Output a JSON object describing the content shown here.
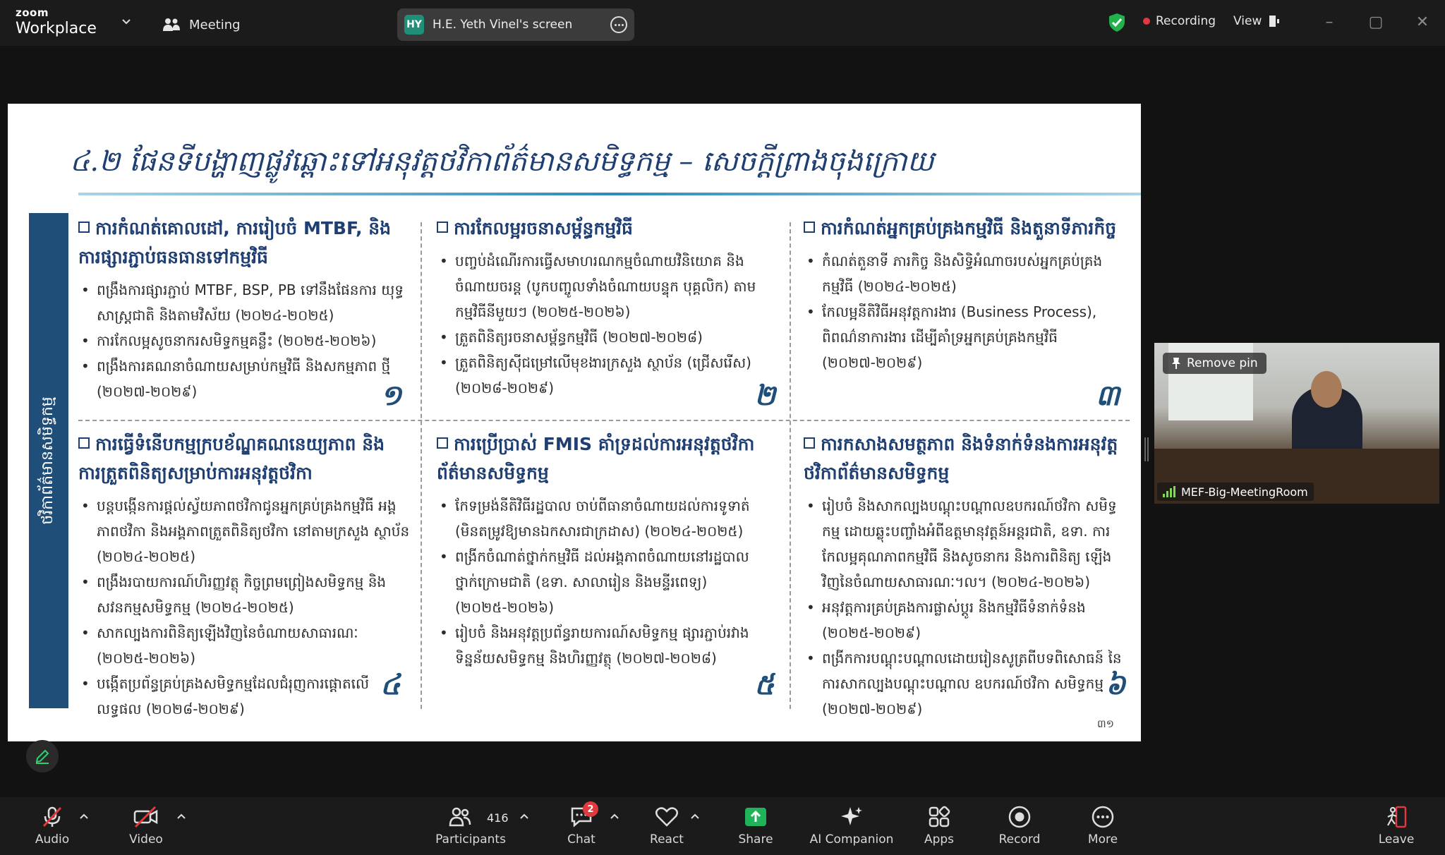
{
  "app": {
    "brand_small": "zoom",
    "brand_big": "Workplace"
  },
  "topbar": {
    "meeting_label": "Meeting",
    "screen_initials": "HY",
    "screen_label": "H.E. Yeth Vinel's screen",
    "recording_label": "Recording",
    "view_label": "View"
  },
  "slide": {
    "title": "៤.២ ផែនទីបង្ហាញផ្លូវឆ្ពោះទៅអនុវត្តថវិកាព័ត៌មានសមិទ្ធកម្ម – សេចក្តីព្រាងចុងក្រោយ",
    "side_label": "ថវិកាព័ត៌មានសមិទ្ធកម្ម",
    "page_number": "៣១",
    "cells": [
      {
        "heading": "ការកំណត់គោលដៅ, ការរៀបចំ MTBF, និង ការផ្សារភ្ជាប់ធនធានទៅកម្មវិធី",
        "bullets": [
          "ពង្រឹងការផ្សារភ្ជាប់ MTBF, BSP, PB ទៅនឹងផែនការ យុទ្ធសាស្ត្រជាតិ និងតាមវិស័យ (២០២៤-២០២៥)",
          "ការកែលម្អសូចនាករសមិទ្ធកម្មគន្លឹះ (២០២៥-២០២៦)",
          "ពង្រឹងការគណនាចំណាយសម្រាប់កម្មវិធី និងសកម្មភាព ថ្មី (២០២៧-២០២៩)"
        ],
        "number": "១"
      },
      {
        "heading": "ការកែលម្អរចនាសម្ព័ន្ធកម្មវិធី",
        "bullets": [
          "បញ្ចប់ដំណើរការធ្វើសមាហរណកម្មចំណាយវិនិយោគ និងចំណាយចរន្ត (បូកបញ្ចូលទាំងចំណាយបន្ទុក បុគ្គលិក) តាមកម្មវិធីនីមួយៗ (២០២៥-២០២៦)",
          "ត្រួតពិនិត្យរចនាសម្ព័ន្ធកម្មវិធី (២០២៧-២០២៨)",
          "ត្រួតពិនិត្យស៊ីជម្រៅលើមុខងារក្រសួង ស្ថាប័ន (ជ្រើសរើស) (២០២៨-២០២៩)"
        ],
        "number": "២"
      },
      {
        "heading": "ការកំណត់អ្នកគ្រប់គ្រងកម្មវិធី និងតួនាទីភារកិច្ច",
        "bullets": [
          "កំណត់តួនាទី ភារកិច្ច និងសិទ្ធិអំណាចរបស់អ្នកគ្រប់គ្រង កម្មវិធី (២០២៤-២០២៥)",
          "កែលម្អនីតិវិធីអនុវត្តការងារ (Business Process), ពិពណ៌នាការងារ ដើម្បីគាំទ្រអ្នកគ្រប់គ្រងកម្មវិធី (២០២៧-២០២៩)"
        ],
        "number": "៣"
      },
      {
        "heading": "ការធ្វើទំនើបកម្មក្របខ័ណ្ឌគណនេយ្យភាព និង ការត្រួតពិនិត្យសម្រាប់ការអនុវត្តថវិកា",
        "bullets": [
          "បន្តបង្កើនការផ្តល់ស្វ័យភាពថវិកាជូនអ្នកគ្រប់គ្រងកម្មវិធី អង្គភាពថវិកា និងអង្គភាពត្រួតពិនិត្យថវិកា នៅតាមក្រសួង ស្ថាប័ន (២០២៤-២០២៥)",
          "ពង្រឹងរបាយការណ៍ហិរញ្ញវត្ថុ កិច្ចព្រមព្រៀងសមិទ្ធកម្ម និង សវនកម្មសមិទ្ធកម្ម (២០២៤-២០២៥)",
          "សាកល្បងការពិនិត្យឡើងវិញនៃចំណាយសាធារណៈ (២០២៥-២០២៦)",
          "បង្កើតប្រព័ន្ធគ្រប់គ្រងសមិទ្ធកម្មដែលជំរុញការផ្តោតលើ លទ្ធផល (២០២៨-២០២៩)"
        ],
        "number": "៤"
      },
      {
        "heading": "ការប្រើប្រាស់ FMIS គាំទ្រដល់ការអនុវត្តថវិកា ព័ត៌មានសមិទ្ធកម្ម",
        "bullets": [
          "កែទម្រង់នីតិវិធីរដ្ឋបាល ចាប់ពីធានាចំណាយដល់ការទូទាត់ (មិនតម្រូវឱ្យមានឯកសារជាក្រដាស) (២០២៤-២០២៥)",
          "ពង្រីកចំណាត់ថ្នាក់កម្មវិធី ដល់អង្គភាពចំណាយនៅរដ្ឋបាល ថ្នាក់ក្រោមជាតិ (ឧទា. សាលារៀន និងមន្ទីរពេទ្យ) (២០២៥-២០២៦)",
          "រៀបចំ និងអនុវត្តប្រព័ន្ធរាយការណ៍សមិទ្ធកម្ម ផ្សារភ្ជាប់រវាង ទិន្នន័យសមិទ្ធកម្ម និងហិរញ្ញវត្ថុ (២០២៧-២០២៨)"
        ],
        "number": "៥"
      },
      {
        "heading": "ការកសាងសមត្ថភាព និងទំនាក់ទំនងការអនុវត្ត ថវិកាព័ត៌មានសមិទ្ធកម្ម",
        "bullets": [
          "រៀបចំ និងសាកល្បងបណ្តុះបណ្តាលឧបករណ៍ថវិកា សមិទ្ធកម្ម ដោយឆ្លុះបញ្ចាំងអំពីឧត្តមានុវត្តន៍អន្តរជាតិ, ឧទា. ការកែលម្អគុណភាពកម្មវិធី និងសូចនាករ និងការពិនិត្យ ឡើងវិញនៃចំណាយសាធារណៈ។ល។ (២០២៤-២០២៦)",
          "អនុវត្តការគ្រប់គ្រងការផ្លាស់ប្តូរ និងកម្មវិធីទំនាក់ទំនង (២០២៥-២០២៩)",
          "ពង្រីកការបណ្តុះបណ្តាលដោយរៀនសូត្រពីបទពិសោធន៍ នៃការសាកល្បងបណ្តុះបណ្តាល ឧបករណ៍ថវិកា សមិទ្ធកម្ម (២០២៧-២០២៩)"
        ],
        "number": "៦"
      }
    ]
  },
  "video": {
    "remove_pin_label": "Remove pin",
    "participant_name": "MEF-Big-MeetingRoom"
  },
  "toolbar": {
    "audio": "Audio",
    "video": "Video",
    "participants": "Participants",
    "participants_count": "416",
    "chat": "Chat",
    "chat_badge": "2",
    "react": "React",
    "share": "Share",
    "ai_companion": "AI Companion",
    "apps": "Apps",
    "record": "Record",
    "more": "More",
    "leave": "Leave"
  },
  "colors": {
    "share_green": "#1fb45a",
    "leave_red": "#e0393e",
    "slide_blue": "#1f4e79",
    "secure_green": "#22b24c"
  }
}
